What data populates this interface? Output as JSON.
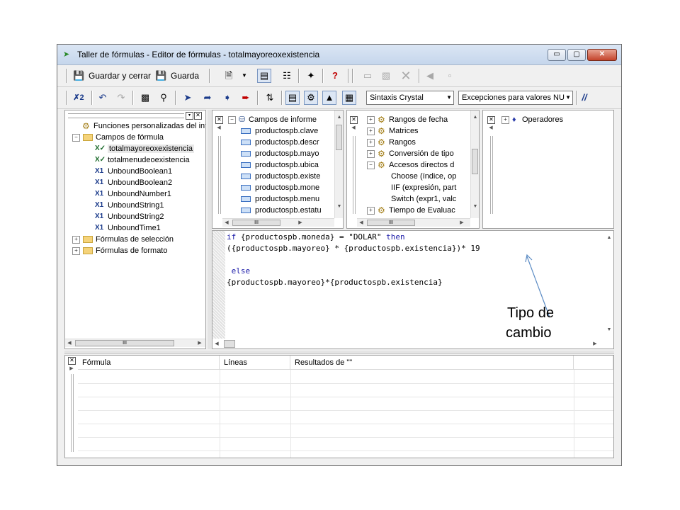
{
  "window": {
    "title": "Taller de fórmulas - Editor de fórmulas - totalmayoreoxexistencia",
    "controls": {
      "minimize": "▭",
      "maximize": "▢",
      "close": "✕"
    }
  },
  "toolbar1": {
    "save_close_label": "Guardar y cerrar",
    "save_label": "Guarda"
  },
  "toolbar2": {
    "syntax_combo": "Sintaxis Crystal",
    "exceptions_combo": "Excepciones para valores NU",
    "comment_label": "//"
  },
  "workshop_tree": {
    "items": [
      {
        "label": "Funciones personalizadas del inf",
        "kind": "custom"
      },
      {
        "label": "Campos de fórmula",
        "kind": "folder",
        "expander": "−"
      },
      {
        "label": "totalmayoreoxexistencia",
        "kind": "formula-check",
        "selected": true
      },
      {
        "label": "totalmenudeoexistencia",
        "kind": "formula-check"
      },
      {
        "label": "UnboundBoolean1",
        "kind": "formula"
      },
      {
        "label": "UnboundBoolean2",
        "kind": "formula"
      },
      {
        "label": "UnboundNumber1",
        "kind": "formula"
      },
      {
        "label": "UnboundString1",
        "kind": "formula"
      },
      {
        "label": "UnboundString2",
        "kind": "formula"
      },
      {
        "label": "UnboundTime1",
        "kind": "formula"
      },
      {
        "label": "Fórmulas de selección",
        "kind": "folder",
        "expander": "+"
      },
      {
        "label": "Fórmulas de formato",
        "kind": "folder",
        "expander": "+"
      }
    ],
    "hscroll_grip": "III"
  },
  "fields_panel": {
    "root_label": "Campos de informe",
    "items": [
      "productospb.clave",
      "productospb.descr",
      "productospb.mayo",
      "productospb.ubica",
      "productospb.existe",
      "productospb.mone",
      "productospb.menu",
      "productospb.estatu"
    ],
    "hscroll_grip": "III"
  },
  "functions_panel": {
    "items": [
      {
        "label": "Rangos de fecha",
        "expander": "+",
        "level": 0
      },
      {
        "label": "Matrices",
        "expander": "+",
        "level": 0
      },
      {
        "label": "Rangos",
        "expander": "+",
        "level": 0
      },
      {
        "label": "Conversión de tipo",
        "expander": "+",
        "level": 0
      },
      {
        "label": "Accesos directos d",
        "expander": "−",
        "level": 0
      },
      {
        "label": "Choose (índice, op",
        "expander": "",
        "level": 1
      },
      {
        "label": "IIF (expresión, part",
        "expander": "",
        "level": 1
      },
      {
        "label": "Switch (expr1, valc",
        "expander": "",
        "level": 1
      },
      {
        "label": "Tiempo de Evaluac",
        "expander": "+",
        "level": 0
      }
    ],
    "hscroll_grip": "III"
  },
  "operators_panel": {
    "root_label": "Operadores"
  },
  "editor": {
    "lines": [
      {
        "parts": [
          {
            "t": "if",
            "kw": true
          },
          {
            "t": " {productospb.moneda} = \"DOLAR\" ",
            "kw": false
          },
          {
            "t": "then",
            "kw": true
          }
        ]
      },
      {
        "parts": [
          {
            "t": "({productospb.mayoreo} * {productospb.existencia})* 19",
            "kw": false
          }
        ]
      },
      {
        "parts": [
          {
            "t": "",
            "kw": false
          }
        ]
      },
      {
        "parts": [
          {
            "t": " else",
            "kw": true
          }
        ]
      },
      {
        "parts": [
          {
            "t": "{productospb.mayoreo}*{productospb.existencia}",
            "kw": false
          }
        ]
      }
    ],
    "annotation": {
      "line1": "Tipo de",
      "line2": "cambio"
    }
  },
  "results": {
    "columns": [
      "Fórmula",
      "Líneas",
      "Resultados de \"\""
    ]
  },
  "colors": {
    "titlebar": "#c5d6ec",
    "keyword": "#1a1aa8",
    "arrow": "#5b8bc4",
    "selection": "#e8e8e8"
  }
}
